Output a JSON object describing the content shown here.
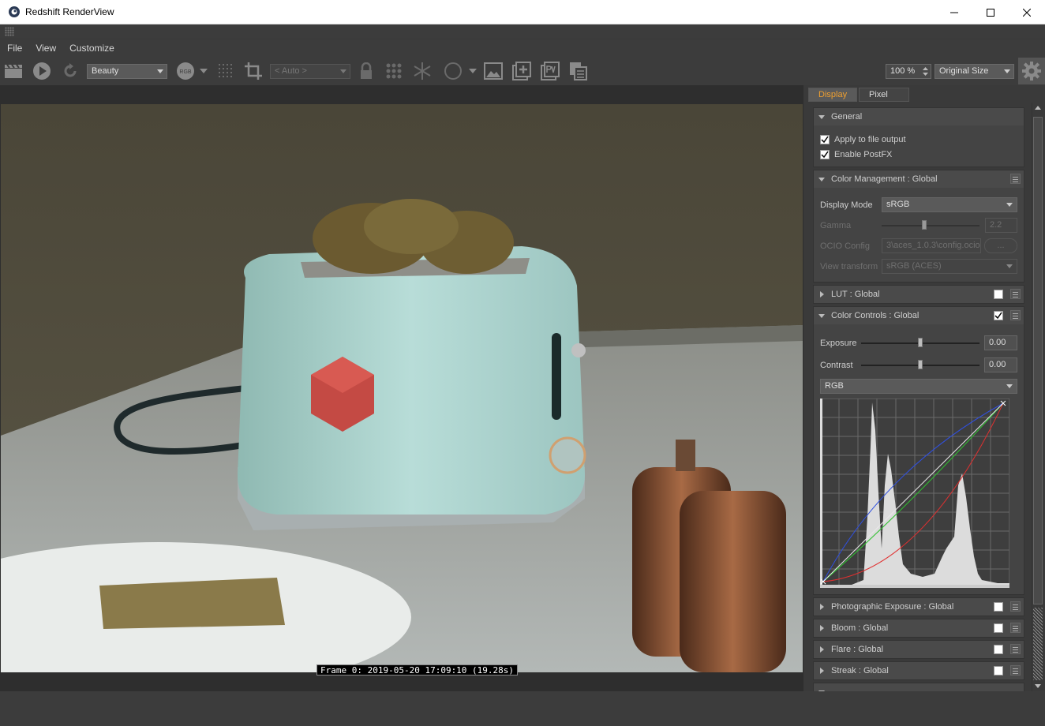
{
  "window": {
    "title": "Redshift RenderView"
  },
  "menu": {
    "file": "File",
    "view": "View",
    "customize": "Customize"
  },
  "toolbar": {
    "aov_select": "Beauty",
    "channel_badge": "RGB",
    "camera_select": "< Auto >",
    "zoom_value": "100 %",
    "size_select": "Original Size"
  },
  "frame_info": "Frame  0:  2019-05-20  17:09:10  (19.28s)",
  "panel": {
    "tabs": {
      "display": "Display",
      "pixel": "Pixel"
    },
    "general": {
      "title": "General",
      "apply_to_file_output": "Apply to file output",
      "enable_postfx": "Enable PostFX"
    },
    "color_management": {
      "title": "Color Management  : Global",
      "display_mode_label": "Display Mode",
      "display_mode_value": "sRGB",
      "gamma_label": "Gamma",
      "gamma_value": "2.2",
      "ocio_label": "OCIO Config",
      "ocio_value": "3\\aces_1.0.3\\config.ocio",
      "ocio_browse": "...",
      "view_transform_label": "View transform",
      "view_transform_value": "sRGB (ACES)"
    },
    "lut": {
      "title": "LUT  : Global"
    },
    "color_controls": {
      "title": "Color Controls  : Global",
      "exposure_label": "Exposure",
      "exposure_value": "0.00",
      "contrast_label": "Contrast",
      "contrast_value": "0.00",
      "channel_select": "RGB"
    },
    "photographic_exposure": {
      "title": "Photographic Exposure  : Global"
    },
    "bloom": {
      "title": "Bloom  : Global"
    },
    "flare": {
      "title": "Flare  : Global"
    },
    "streak": {
      "title": "Streak  : Global"
    }
  },
  "colors": {
    "tab_active_text": "#f0a030",
    "curve_red": "#e03030",
    "curve_green": "#30c030",
    "curve_blue": "#3050e0"
  }
}
